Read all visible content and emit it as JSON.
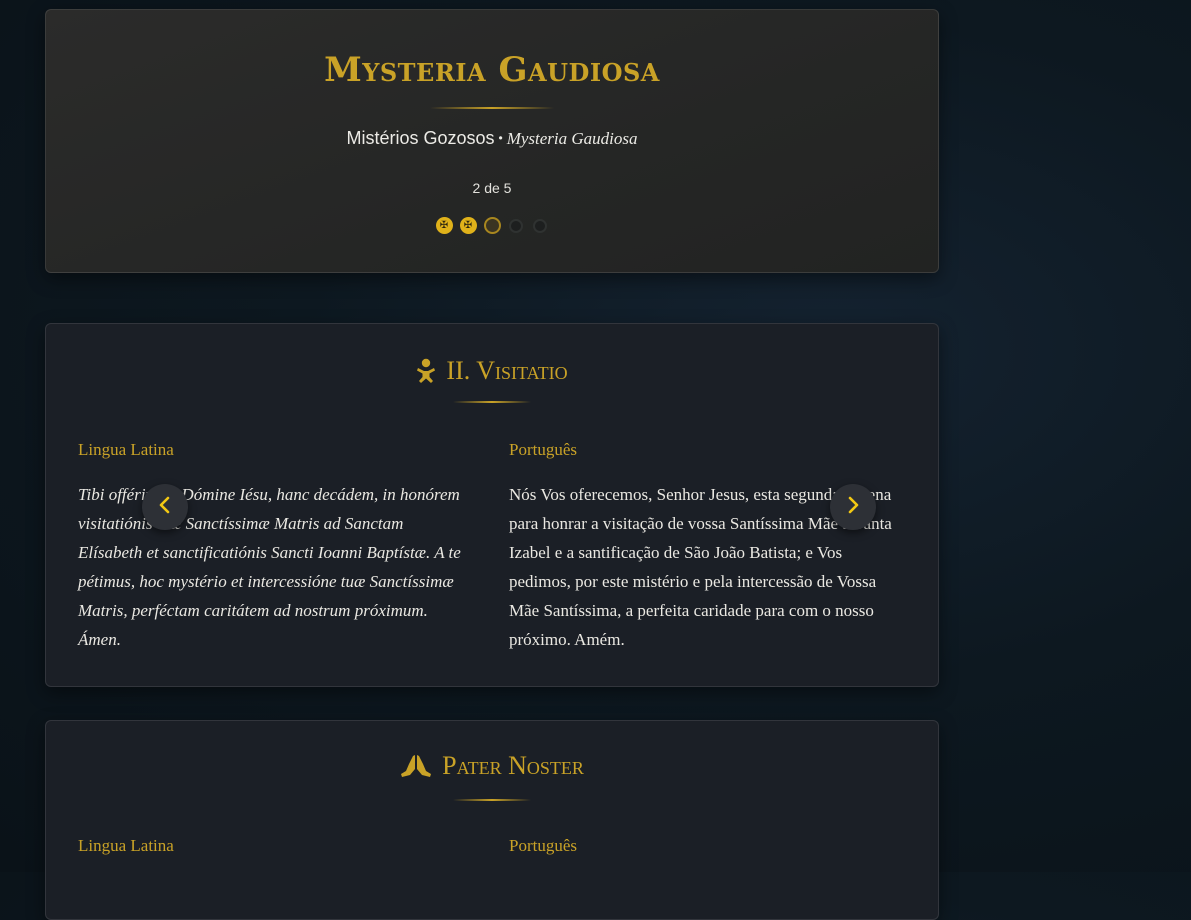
{
  "header": {
    "title": "Mysteria Gaudiosa",
    "subtitle_pt": "Mistérios Gozosos",
    "subtitle_sep": "•",
    "subtitle_la": "Mysteria Gaudiosa",
    "counter": "2 de 5",
    "progress": {
      "states": [
        "done",
        "done",
        "current",
        "pending",
        "pending"
      ],
      "current_index": 2,
      "total": 5
    }
  },
  "mystery": {
    "title": "II. Visitatio",
    "icon": "child-icon",
    "latin_label": "Lingua Latina",
    "portuguese_label": "Português",
    "latin_text": "Tibi offérimus, Dómine Iésu, hanc decádem, in honórem visitatiónis tuæ Sanctíssimæ Matris ad Sanctam Elísabeth et sanctificatiónis Sancti Ioanni Baptístæ. A te pétimus, hoc mystério et intercessióne tuæ Sanctíssimæ Matris, perféctam caritátem ad nostrum próximum. Ámen.",
    "portuguese_text": "Nós Vos oferecemos, Senhor Jesus, esta segunda dezena para honrar a visitação de vossa Santíssima Mãe a Santa Izabel e a santificação de São João Batista; e Vos pedimos, por este mistério e pela intercessão de Vossa Mãe Santíssima, a perfeita caridade para com o nosso próximo. Amém."
  },
  "pater": {
    "title": "Pater Noster",
    "icon": "praying-hands-icon",
    "latin_label": "Lingua Latina",
    "portuguese_label": "Português"
  },
  "nav": {
    "prev_icon": "chevron-left-icon",
    "next_icon": "chevron-right-icon"
  },
  "colors": {
    "accent": "#c9a227",
    "dot_done": "#e0b21a",
    "card_bg": "#1b1f26",
    "header_bg": "#262726"
  }
}
